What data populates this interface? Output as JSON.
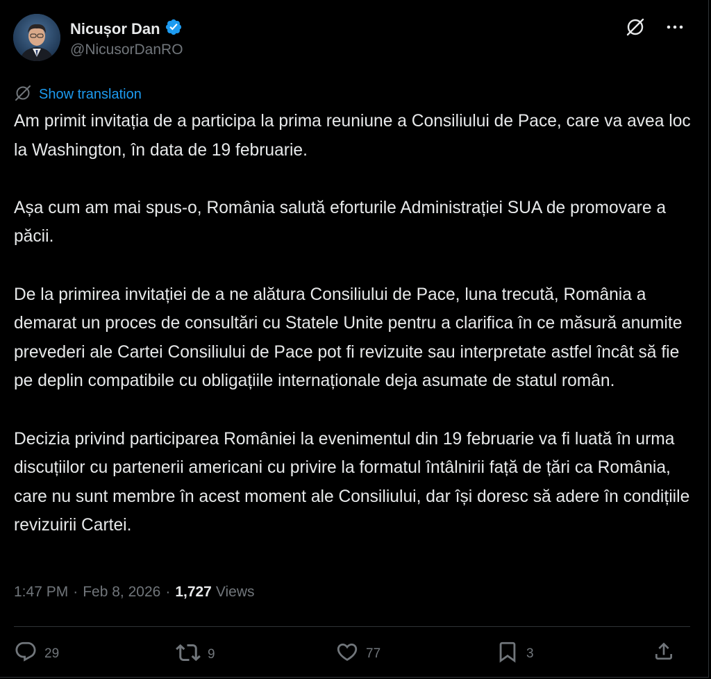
{
  "author": {
    "name": "Nicușor Dan",
    "handle": "@NicusorDanRO",
    "verified": true,
    "verified_color": "#1d9bf0"
  },
  "translate": {
    "label": "Show translation"
  },
  "tweet": {
    "paragraphs": [
      "Am primit invitația de a participa la prima reuniune a Consiliului de Pace, care va avea loc la Washington, în data de 19 februarie.",
      "Așa cum am mai spus-o, România salută eforturile Administrației SUA de promovare a păcii.",
      "De la primirea invitației de a ne alătura Consiliului de Pace, luna trecută, România a demarat un proces de consultări cu Statele Unite pentru a clarifica în ce măsură anumite prevederi ale Cartei Consiliului de Pace pot fi revizuite sau interpretate astfel încât să fie pe deplin compatibile cu obligațiile internaționale deja asumate de statul român.",
      "Decizia privind participarea României la evenimentul din 19 februarie va fi luată în urma discuțiilor cu partenerii americani cu privire la formatul întâlnirii față de țări ca România, care nu sunt membre în acest moment ale Consiliului, dar își doresc să adere în condițiile revizuirii Cartei."
    ]
  },
  "meta": {
    "time": "1:47 PM",
    "separator": "·",
    "date": "Feb 8, 2026",
    "views_count": "1,727",
    "views_label": "Views"
  },
  "actions": {
    "replies": "29",
    "reposts": "9",
    "likes": "77",
    "bookmarks": "3"
  },
  "colors": {
    "background": "#000000",
    "text": "#e7e9ea",
    "muted": "#71767b",
    "link": "#1d9bf0",
    "border": "#2f3336"
  }
}
